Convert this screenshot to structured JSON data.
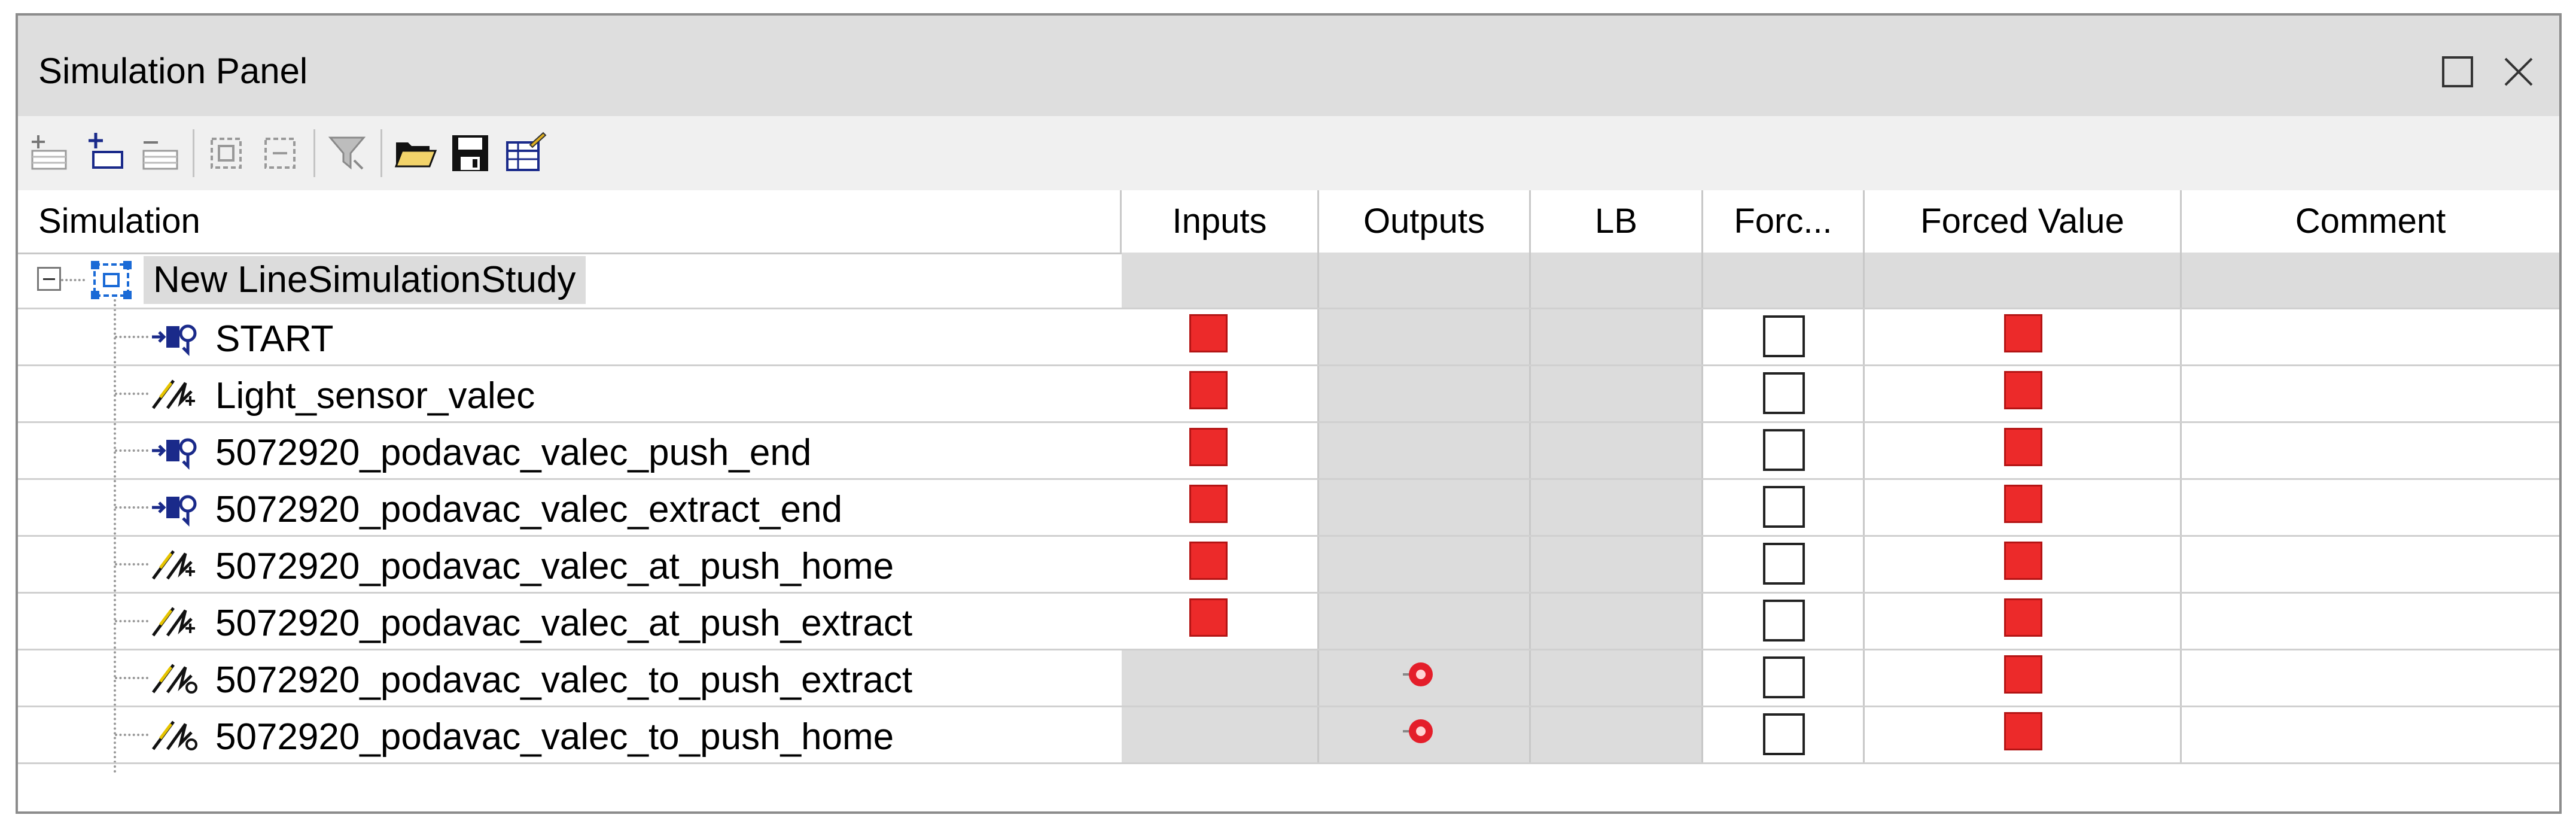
{
  "window": {
    "title": "Simulation Panel",
    "maximize_icon": "maximize-icon",
    "close_icon": "close-icon"
  },
  "toolbar": {
    "buttons": [
      {
        "name": "add-signal-icon"
      },
      {
        "name": "add-device-icon"
      },
      {
        "name": "remove-signal-icon"
      },
      {
        "name": "group-icon"
      },
      {
        "name": "ungroup-icon"
      },
      {
        "name": "filter-icon"
      },
      {
        "name": "open-folder-icon"
      },
      {
        "name": "save-icon"
      },
      {
        "name": "edit-table-icon"
      }
    ]
  },
  "columns": [
    "Simulation",
    "Inputs",
    "Outputs",
    "LB",
    "Forc...",
    "Forced Value",
    "Comment"
  ],
  "root": {
    "label": "New LineSimulationStudy",
    "icon": "study-icon",
    "expanded": true
  },
  "rows": [
    {
      "label": "START",
      "icon": "input-device-icon",
      "type": "input",
      "forced": false
    },
    {
      "label": "Light_sensor_valec",
      "icon": "sensor-signal-icon",
      "type": "input",
      "forced": false
    },
    {
      "label": "5072920_podavac_valec_push_end",
      "icon": "input-device-icon",
      "type": "input",
      "forced": false
    },
    {
      "label": "5072920_podavac_valec_extract_end",
      "icon": "input-device-icon",
      "type": "input",
      "forced": false
    },
    {
      "label": "5072920_podavac_valec_at_push_home",
      "icon": "sensor-signal-icon",
      "type": "input",
      "forced": false
    },
    {
      "label": "5072920_podavac_valec_at_push_extract",
      "icon": "sensor-signal-icon",
      "type": "input",
      "forced": false
    },
    {
      "label": "5072920_podavac_valec_to_push_extract",
      "icon": "output-signal-icon",
      "type": "output",
      "forced": false
    },
    {
      "label": "5072920_podavac_valec_to_push_home",
      "icon": "output-signal-icon",
      "type": "output",
      "forced": false
    }
  ],
  "colors": {
    "signal_off": "#ec2a2a",
    "cell_grey": "#dcdcdc",
    "titlebar": "#dedede"
  }
}
